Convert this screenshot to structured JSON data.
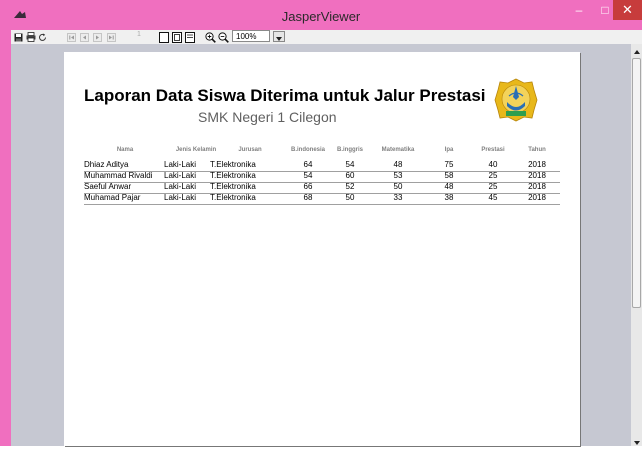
{
  "window": {
    "title": "JasperViewer",
    "buttons": {
      "minimize": "–",
      "maximize": "□",
      "close": "✕"
    }
  },
  "toolbar": {
    "page_number": "1",
    "zoom": "100%",
    "icons": [
      "save-icon",
      "print-icon",
      "reload-icon",
      "first-page-icon",
      "previous-page-icon",
      "next-page-icon",
      "last-page-icon",
      "actual-size-icon",
      "fit-page-icon",
      "fit-width-icon",
      "zoom-in-icon",
      "zoom-out-icon"
    ]
  },
  "report": {
    "title": "Laporan Data Siswa Diterima untuk Jalur Prestasi",
    "subtitle": "SMK Negeri 1 Cilegon",
    "columns": [
      "Nama",
      "Jenis Kelamin",
      "Jurusan",
      "B.indonesia",
      "B.inggris",
      "Matematika",
      "Ipa",
      "Prestasi",
      "Tahun"
    ],
    "rows": [
      [
        "Dhiaz Aditya",
        "Laki-Laki",
        "T.Elektronika",
        "64",
        "54",
        "48",
        "75",
        "40",
        "2018"
      ],
      [
        "Muhammad Rivaldi",
        "Laki-Laki",
        "T.Elektronika",
        "54",
        "60",
        "53",
        "58",
        "25",
        "2018"
      ],
      [
        "Saeful Anwar",
        "Laki-Laki",
        "T.Elektronika",
        "66",
        "52",
        "50",
        "48",
        "25",
        "2018"
      ],
      [
        "Muhamad Pajar",
        "Laki-Laki",
        "T.Elektronika",
        "68",
        "50",
        "33",
        "38",
        "45",
        "2018"
      ]
    ]
  },
  "colors": {
    "title_bar": "#f06fbf",
    "viewer_background": "#c6c8d2",
    "close_button": "#c73c3c",
    "logo_gold": "#e8b81a",
    "logo_blue": "#2a6fb5"
  }
}
